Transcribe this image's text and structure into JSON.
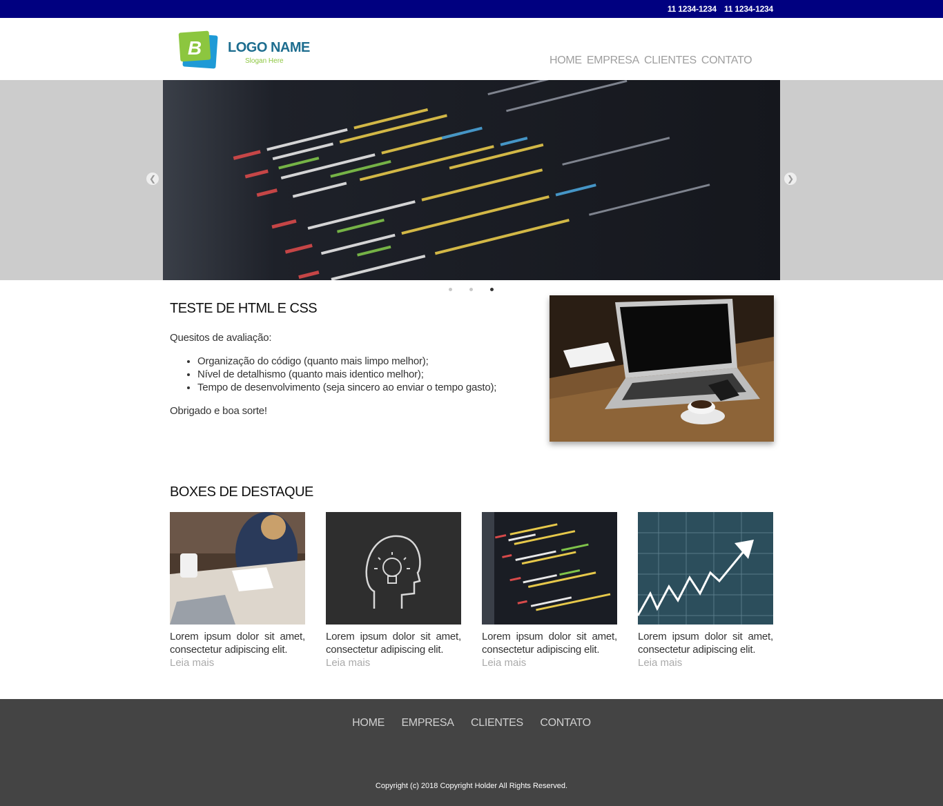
{
  "topbar": {
    "phone1": "11 1234-1234",
    "phone2": "11 1234-1234"
  },
  "logo": {
    "letter": "B",
    "name": "LOGO NAME",
    "slogan": "Slogan Here",
    "colors": {
      "green": "#8cc63f",
      "blue": "#1e9ad6",
      "text": "#1d6d8f"
    }
  },
  "nav": [
    "HOME",
    "EMPRESA",
    "CLIENTES",
    "CONTATO"
  ],
  "slider": {
    "prev_icon": "chevron-left-icon",
    "next_icon": "chevron-right-icon",
    "slide_count": 3,
    "active_slide": 3
  },
  "intro": {
    "title": "TESTE DE HTML E CSS",
    "lead": "Quesitos de avaliação:",
    "items": [
      "Organização do código (quanto mais limpo melhor);",
      "Nível de detalhismo (quanto mais identico melhor);",
      "Tempo de desenvolvimento (seja sincero ao enviar o tempo gasto);"
    ],
    "closing": "Obrigado e boa sorte!"
  },
  "boxes": {
    "title": "BOXES DE DESTAQUE",
    "items": [
      {
        "text": "Lorem ipsum dolor sit amet, consectetur adipiscing elit.",
        "link": "Leia mais"
      },
      {
        "text": "Lorem ipsum dolor sit amet, consectetur adipiscing elit.",
        "link": "Leia mais"
      },
      {
        "text": "Lorem ipsum dolor sit amet, consectetur adipiscing elit.",
        "link": "Leia mais"
      },
      {
        "text": "Lorem ipsum dolor sit amet, consectetur adipiscing elit.",
        "link": "Leia mais"
      }
    ]
  },
  "footer": {
    "nav": [
      "HOME",
      "EMPRESA",
      "CLIENTES",
      "CONTATO"
    ],
    "copyright": "Copyright (c) 2018 Copyright Holder All Rights Reserved."
  },
  "colors": {
    "topbar": "#000080",
    "footer": "#444444",
    "nav_text": "#9e9e9e"
  }
}
